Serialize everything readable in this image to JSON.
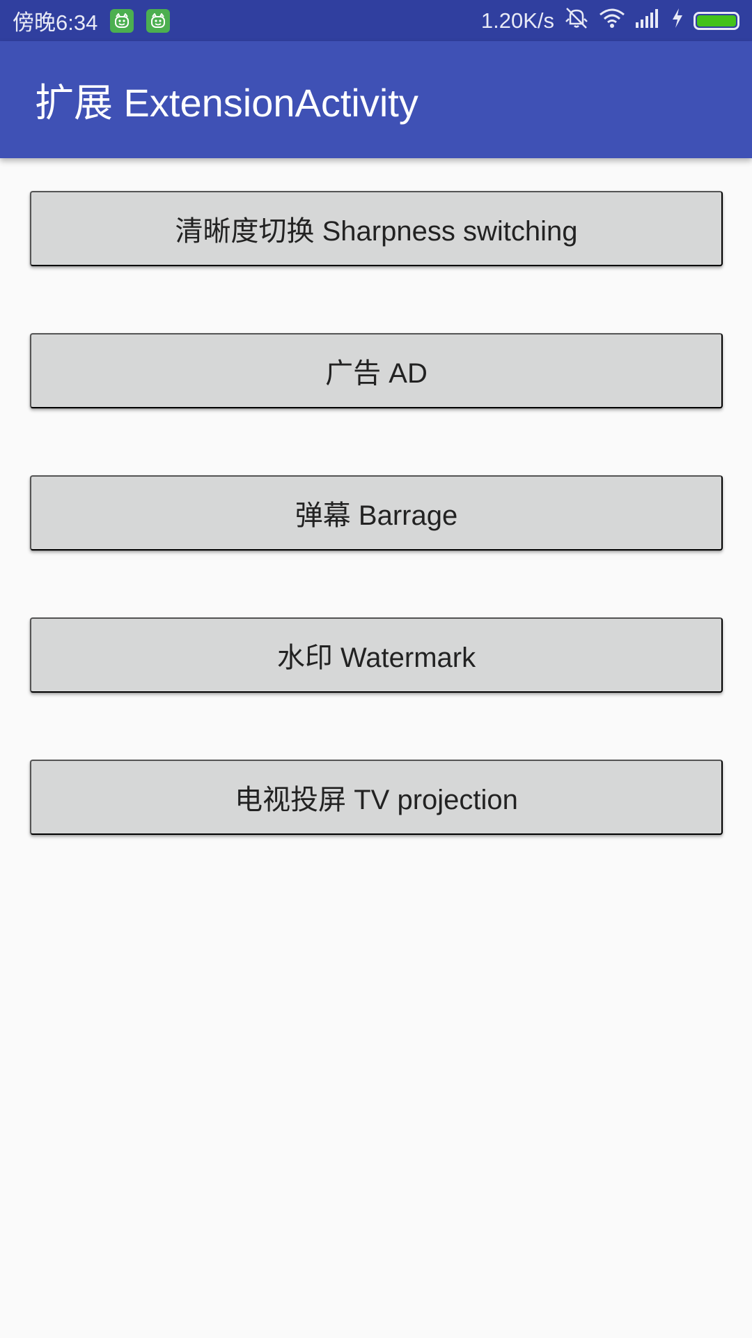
{
  "status_bar": {
    "time": "傍晚6:34",
    "network_speed": "1.20K/s",
    "icons": [
      "app-notification-icon",
      "app-notification-icon",
      "vibrate-off-icon",
      "wifi-icon",
      "signal-icon",
      "charging-icon",
      "battery-icon"
    ],
    "battery_level": 1.0,
    "battery_color": "#43c21a"
  },
  "app_bar": {
    "title": "扩展 ExtensionActivity",
    "background": "#3f51b5"
  },
  "buttons": [
    {
      "label": "清晰度切换 Sharpness switching"
    },
    {
      "label": "广告 AD"
    },
    {
      "label": "弹幕 Barrage"
    },
    {
      "label": "水印 Watermark"
    },
    {
      "label": "电视投屏 TV projection"
    }
  ]
}
